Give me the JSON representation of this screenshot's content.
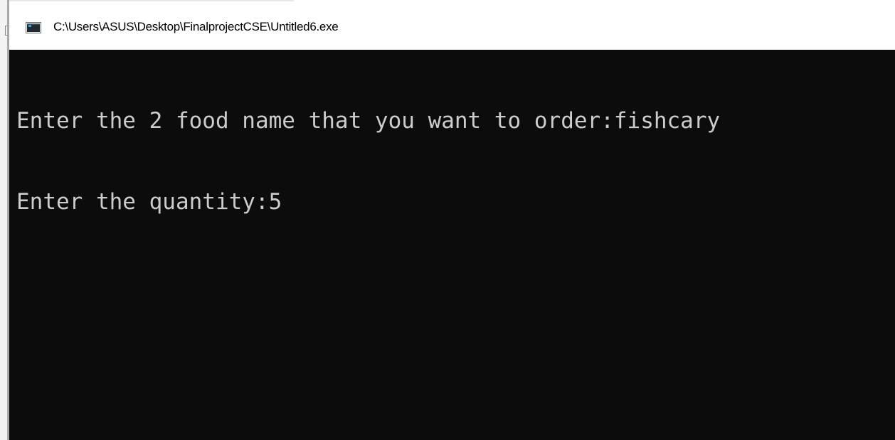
{
  "window": {
    "title": "C:\\Users\\ASUS\\Desktop\\FinalprojectCSE\\Untitled6.exe",
    "icon": "console-app-icon"
  },
  "console": {
    "lines": [
      "Enter the 2 food name that you want to order:fishcary",
      "Enter the quantity:5"
    ]
  },
  "colors": {
    "console_background": "#0c0c0c",
    "console_text": "#cccccc",
    "titlebar_background": "#ffffff"
  }
}
